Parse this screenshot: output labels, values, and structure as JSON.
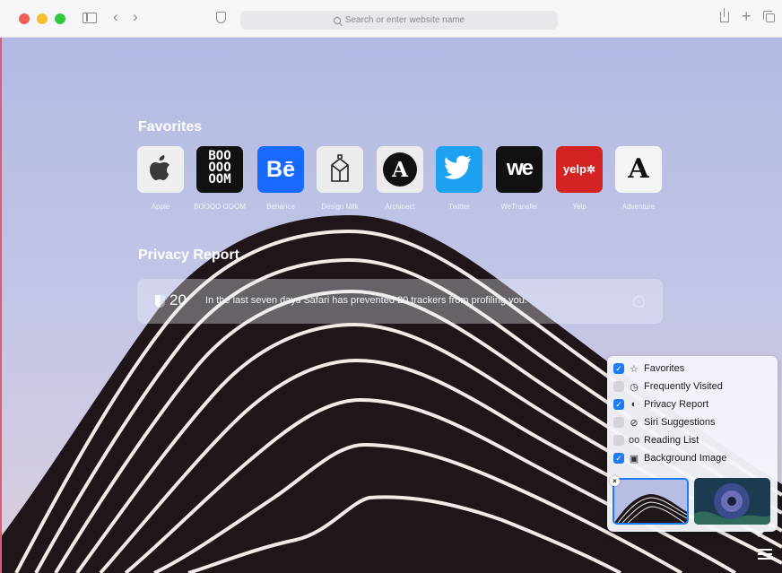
{
  "toolbar": {
    "address_placeholder": "Search or enter website name",
    "traffic_lights": [
      "#ee5f57",
      "#f5bd30",
      "#2fc840"
    ]
  },
  "favorites": {
    "title": "Favorites",
    "items": [
      {
        "label": "Apple",
        "tile_text": "",
        "icon": "apple-logo-icon"
      },
      {
        "label": "BOOOO OOOM",
        "tile_text": "BOO\nOOO\nOOM",
        "icon": "booooom-logo"
      },
      {
        "label": "Behance",
        "tile_text": "Bē",
        "icon": "behance-logo"
      },
      {
        "label": "Design Milk",
        "tile_text": "",
        "icon": "design-milk-carton-icon"
      },
      {
        "label": "Archinect",
        "tile_text": "A",
        "icon": "archinect-logo"
      },
      {
        "label": "Twitter",
        "tile_text": "",
        "icon": "twitter-bird-icon"
      },
      {
        "label": "WeTransfer",
        "tile_text": "we",
        "icon": "wetransfer-logo"
      },
      {
        "label": "Yelp",
        "tile_text": "yelp",
        "icon": "yelp-logo"
      },
      {
        "label": "Adventure",
        "tile_text": "A",
        "icon": "adventure-logo"
      }
    ]
  },
  "privacy_report": {
    "title": "Privacy Report",
    "count": "20",
    "message": "In the last seven days Safari has prevented 20 trackers from profiling you."
  },
  "customize": {
    "options": [
      {
        "label": "Favorites",
        "checked": true,
        "icon": "star-icon",
        "glyph": "☆"
      },
      {
        "label": "Frequently Visited",
        "checked": false,
        "icon": "clock-icon",
        "glyph": "◷"
      },
      {
        "label": "Privacy Report",
        "checked": true,
        "icon": "shield-icon",
        "glyph": "◐"
      },
      {
        "label": "Siri Suggestions",
        "checked": false,
        "icon": "compass-icon",
        "glyph": "⊘"
      },
      {
        "label": "Reading List",
        "checked": false,
        "icon": "glasses-icon",
        "glyph": "oo"
      },
      {
        "label": "Background Image",
        "checked": true,
        "icon": "image-icon",
        "glyph": "▣"
      }
    ],
    "check_mark": "✓",
    "remove_mark": "×"
  },
  "colors": {
    "accent": "#1f7cf6",
    "sky_top": "#aeb6e0",
    "sky_bottom": "#d7ccde"
  }
}
